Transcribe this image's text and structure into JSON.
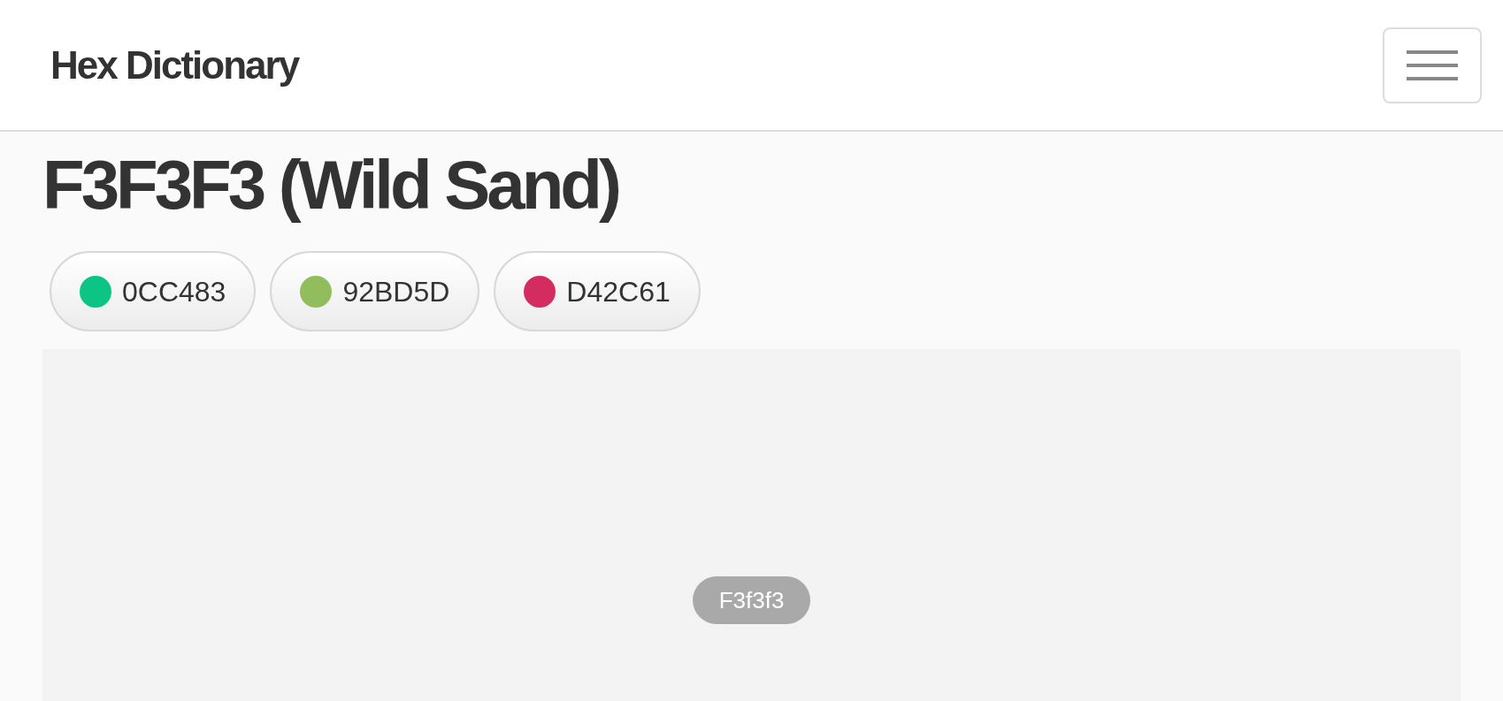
{
  "header": {
    "title": "Hex Dictionary"
  },
  "heading": "F3F3F3 (Wild Sand)",
  "related_colors": [
    {
      "label": "0CC483",
      "color": "#0cc483"
    },
    {
      "label": "92BD5D",
      "color": "#92bd5d"
    },
    {
      "label": "D42C61",
      "color": "#d42c61"
    }
  ],
  "swatch": {
    "color": "#f3f3f3",
    "label": "F3f3f3"
  }
}
